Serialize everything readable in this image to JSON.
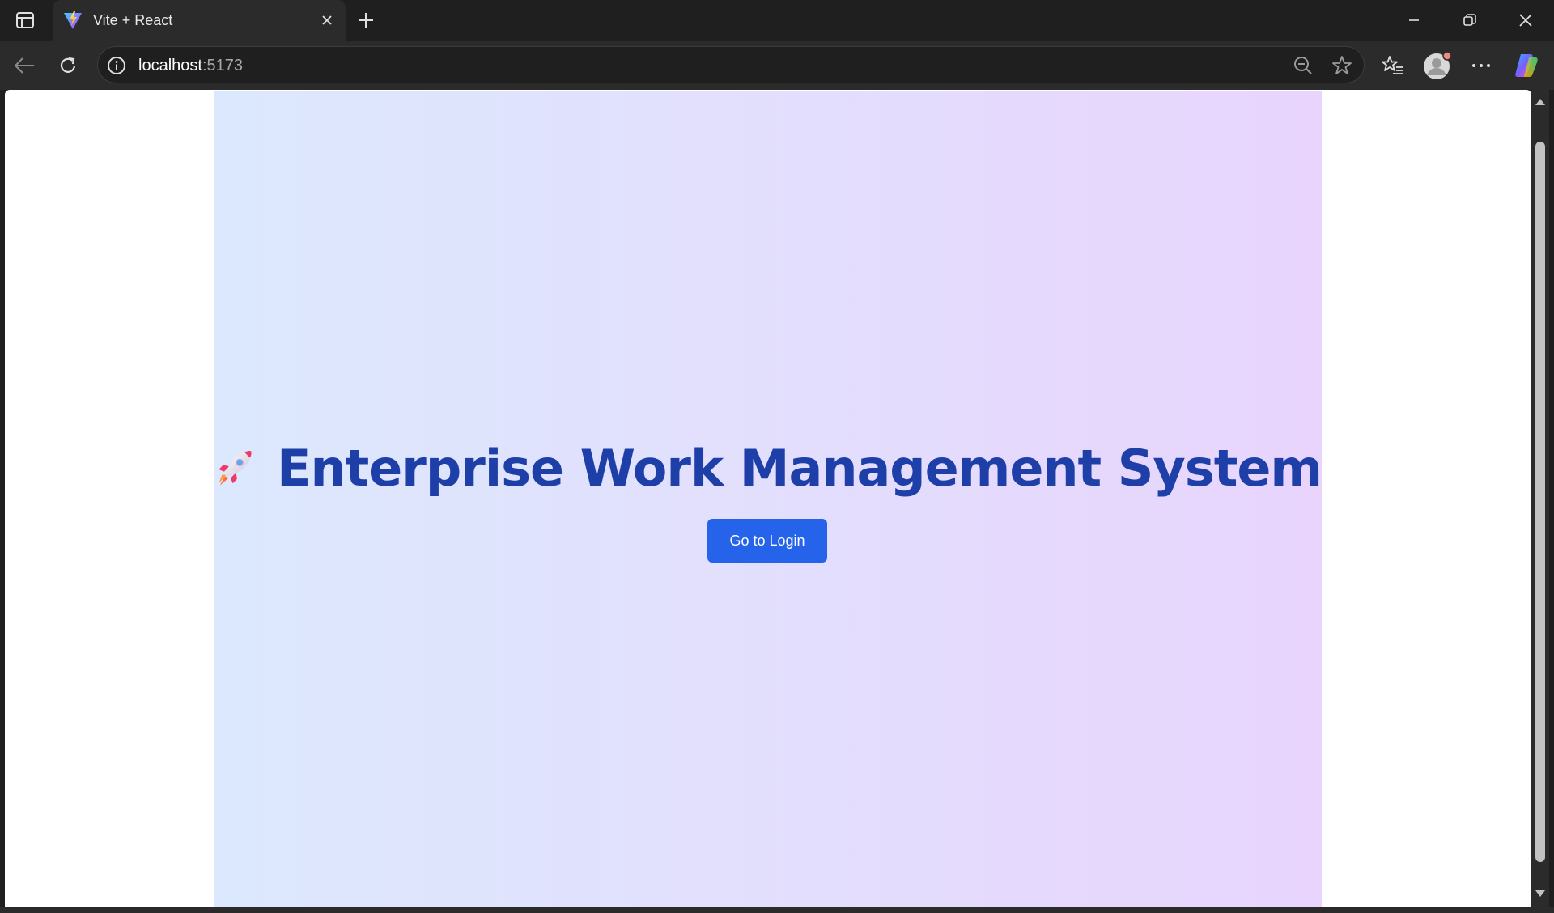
{
  "browser": {
    "tab": {
      "title": "Vite + React",
      "favicon": "vite-logo"
    },
    "address": {
      "host": "localhost",
      "port": ":5173"
    },
    "icons": {
      "sidebar": "sidebar-icon",
      "new_tab": "plus-icon",
      "back": "back-arrow-icon",
      "reload": "reload-icon",
      "info": "info-icon",
      "zoom_out": "zoom-out-icon",
      "favorite": "star-icon",
      "favorites": "favorites-icon",
      "profile": "profile-icon",
      "more": "more-icon",
      "copilot": "copilot-icon"
    },
    "colors": {
      "frame": "#1f1f1f",
      "toolbar": "#2b2b2b"
    }
  },
  "page": {
    "emoji": "rocket-emoji",
    "title": "Enterprise Work Management System",
    "login_button": "Go to Login",
    "colors": {
      "title": "#1e3fa8",
      "button": "#2563eb",
      "gradient_start": "#dce8fd",
      "gradient_end": "#e8d4fd"
    }
  }
}
